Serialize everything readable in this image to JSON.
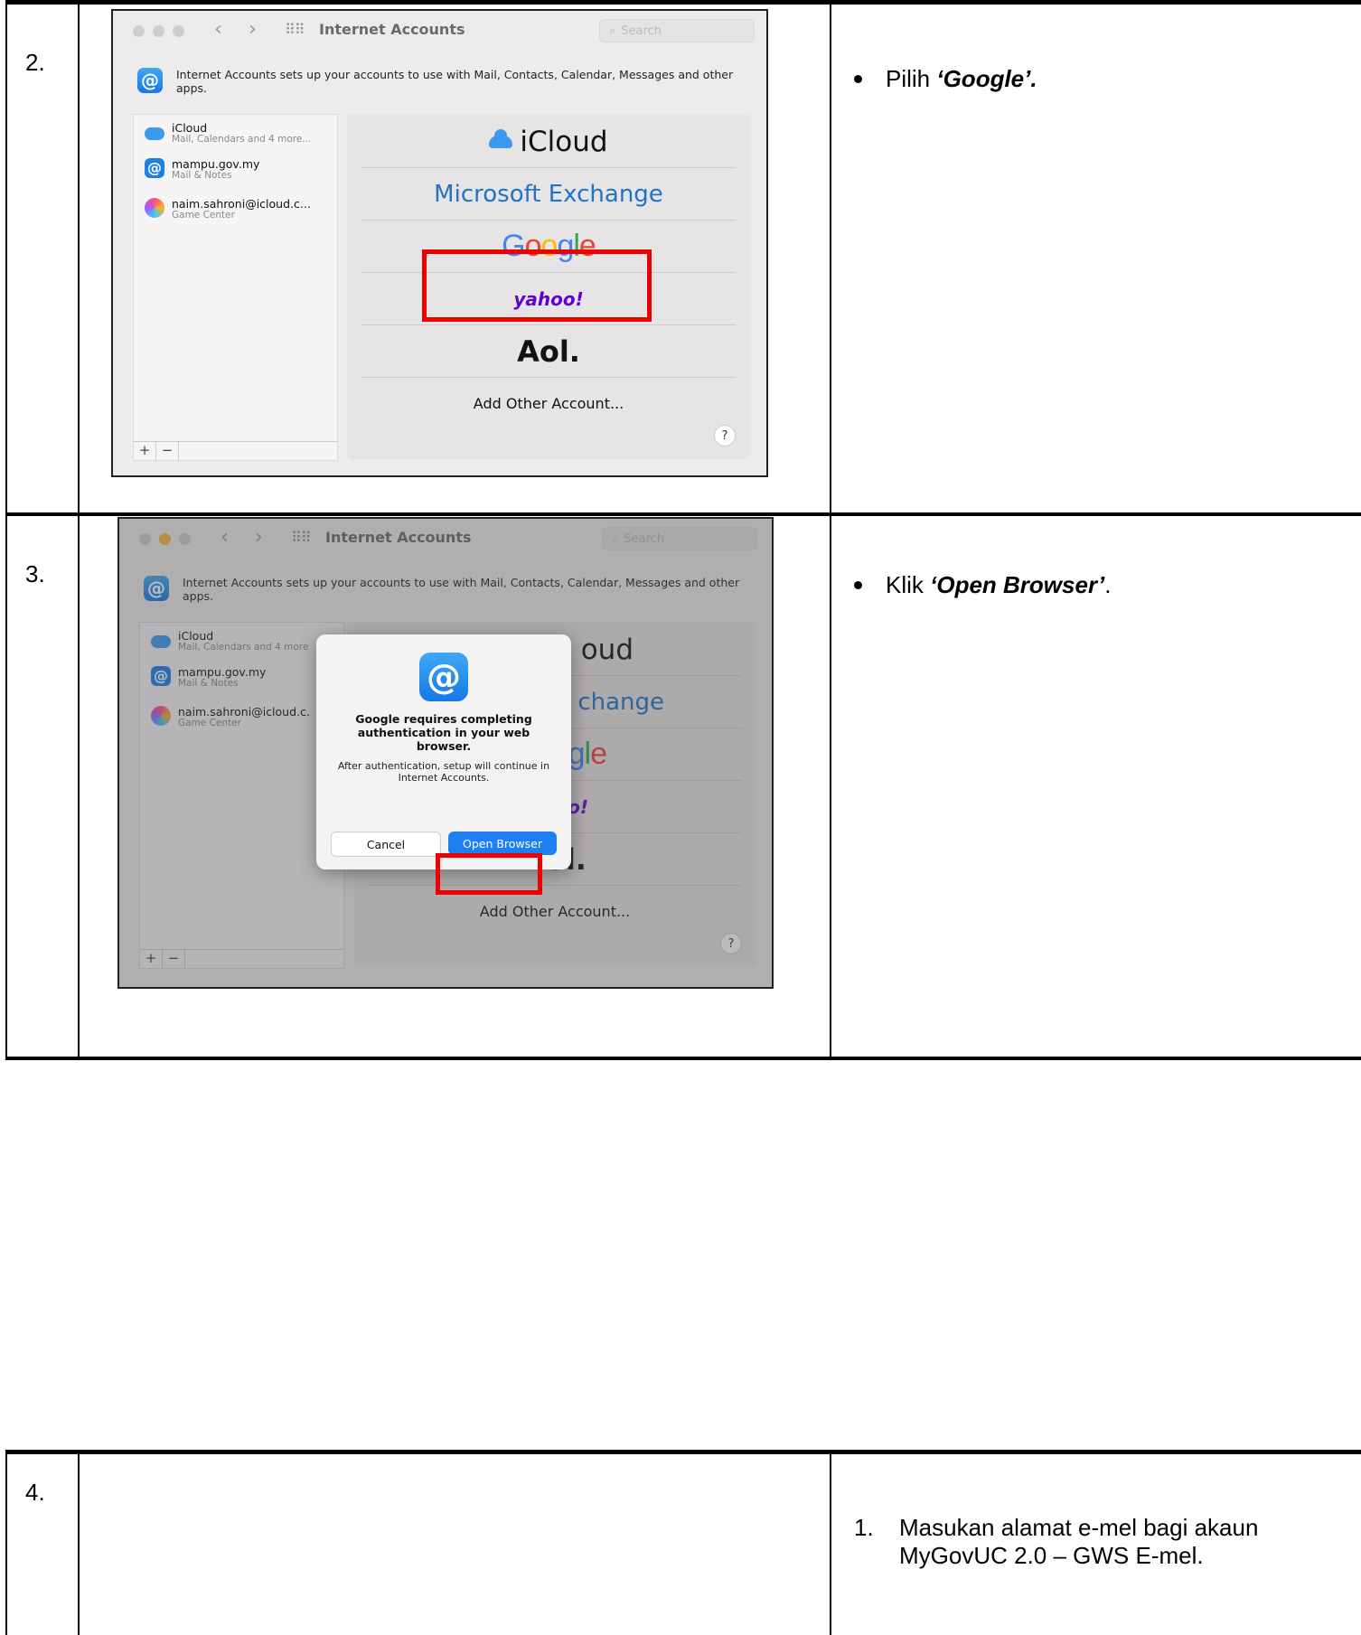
{
  "steps": [
    {
      "number": "2.",
      "instruction_prefix": "Pilih ",
      "instruction_bold": "‘Google’.",
      "instruction_suffix": ""
    },
    {
      "number": "3.",
      "instruction_prefix": "Klik ",
      "instruction_bold": "‘Open Browser’",
      "instruction_suffix": "."
    },
    {
      "number": "4.",
      "list_number": "1.",
      "instruction": "Masukan alamat e-mel bagi akaun MyGovUC 2.0 – GWS E-mel."
    }
  ],
  "window": {
    "title": "Internet Accounts",
    "search_placeholder": "Search",
    "info_text": "Internet Accounts sets up your accounts to use with Mail, Contacts, Calendar, Messages and other apps.",
    "accounts": [
      {
        "name": "iCloud",
        "sub": "Mail, Calendars and 4 more..."
      },
      {
        "name": "mampu.gov.my",
        "sub": "Mail & Notes"
      },
      {
        "name": "naim.sahroni@icloud.c...",
        "sub": "Game Center"
      }
    ],
    "accounts_step3": [
      {
        "name": "iCloud",
        "sub": "Mail, Calendars and 4 more"
      },
      {
        "name": "mampu.gov.my",
        "sub": "Mail & Notes"
      },
      {
        "name": "naim.sahroni@icloud.c.",
        "sub": "Game Center"
      }
    ],
    "providers": {
      "icloud": "iCloud",
      "microsoft": "Microsoft Exchange",
      "google": "Google",
      "yahoo": "yahoo!",
      "aol": "Aol.",
      "other": "Add Other Account..."
    },
    "providers_step3_visible": {
      "icloud": "oud",
      "microsoft": "change",
      "google": "gle",
      "yahoo": "o!",
      "aol": "Aol."
    },
    "add_button": "+",
    "remove_button": "−",
    "help": "?"
  },
  "dialog": {
    "title": "Google requires completing authentication in your web browser.",
    "message": "After authentication, setup will continue in Internet Accounts.",
    "cancel": "Cancel",
    "open": "Open Browser"
  },
  "colors": {
    "highlight": "#e00000",
    "accent_blue": "#1e80f0",
    "microsoft_blue": "#1f74c8",
    "yahoo_purple": "#5f01d1"
  }
}
